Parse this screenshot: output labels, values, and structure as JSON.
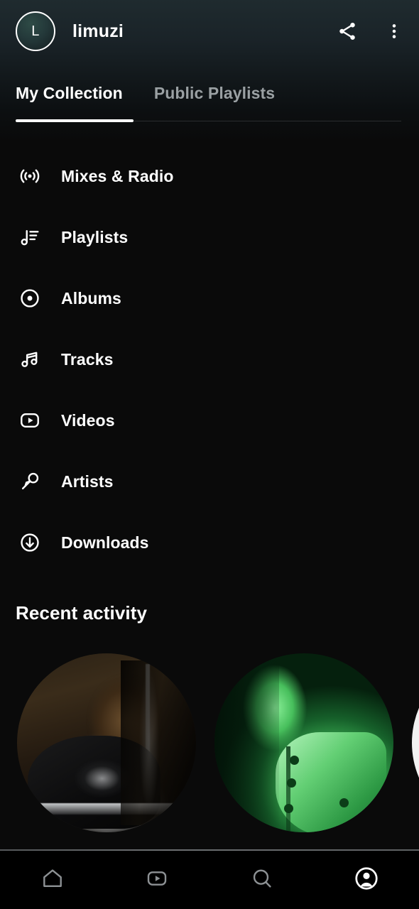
{
  "header": {
    "avatar_letter": "L",
    "username": "limuzi",
    "avatar_name": "avatar",
    "share_label": "Share",
    "more_label": "More options"
  },
  "tabs": [
    {
      "label": "My Collection",
      "active": true
    },
    {
      "label": "Public Playlists",
      "active": false
    }
  ],
  "menu": {
    "items": [
      {
        "label": "Mixes & Radio",
        "icon": "broadcast-icon"
      },
      {
        "label": "Playlists",
        "icon": "playlist-note-icon"
      },
      {
        "label": "Albums",
        "icon": "album-disc-icon"
      },
      {
        "label": "Tracks",
        "icon": "music-note-icon"
      },
      {
        "label": "Videos",
        "icon": "video-play-icon"
      },
      {
        "label": "Artists",
        "icon": "microphone-icon"
      },
      {
        "label": "Downloads",
        "icon": "download-arrow-icon"
      }
    ]
  },
  "recent": {
    "title": "Recent activity",
    "cards": [
      {
        "art": "dark-sepia-portrait"
      },
      {
        "art": "green-tinted-portrait"
      },
      {
        "art": "white-circle-partial"
      }
    ]
  },
  "bottom_nav": {
    "items": [
      {
        "label": "Home",
        "icon": "home-icon",
        "active": false
      },
      {
        "label": "Videos",
        "icon": "video-play-icon",
        "active": false
      },
      {
        "label": "Search",
        "icon": "search-icon",
        "active": false
      },
      {
        "label": "Profile",
        "icon": "profile-icon",
        "active": true
      }
    ]
  },
  "colors": {
    "background": "#0a0a0a",
    "header_gradient_top": "#1f2b2f",
    "active_text": "#ffffff",
    "inactive_text": "#9aa0a3",
    "nav_inactive": "#8d9194",
    "nav_active": "#ffffff",
    "accent_green": "#3cb153"
  }
}
